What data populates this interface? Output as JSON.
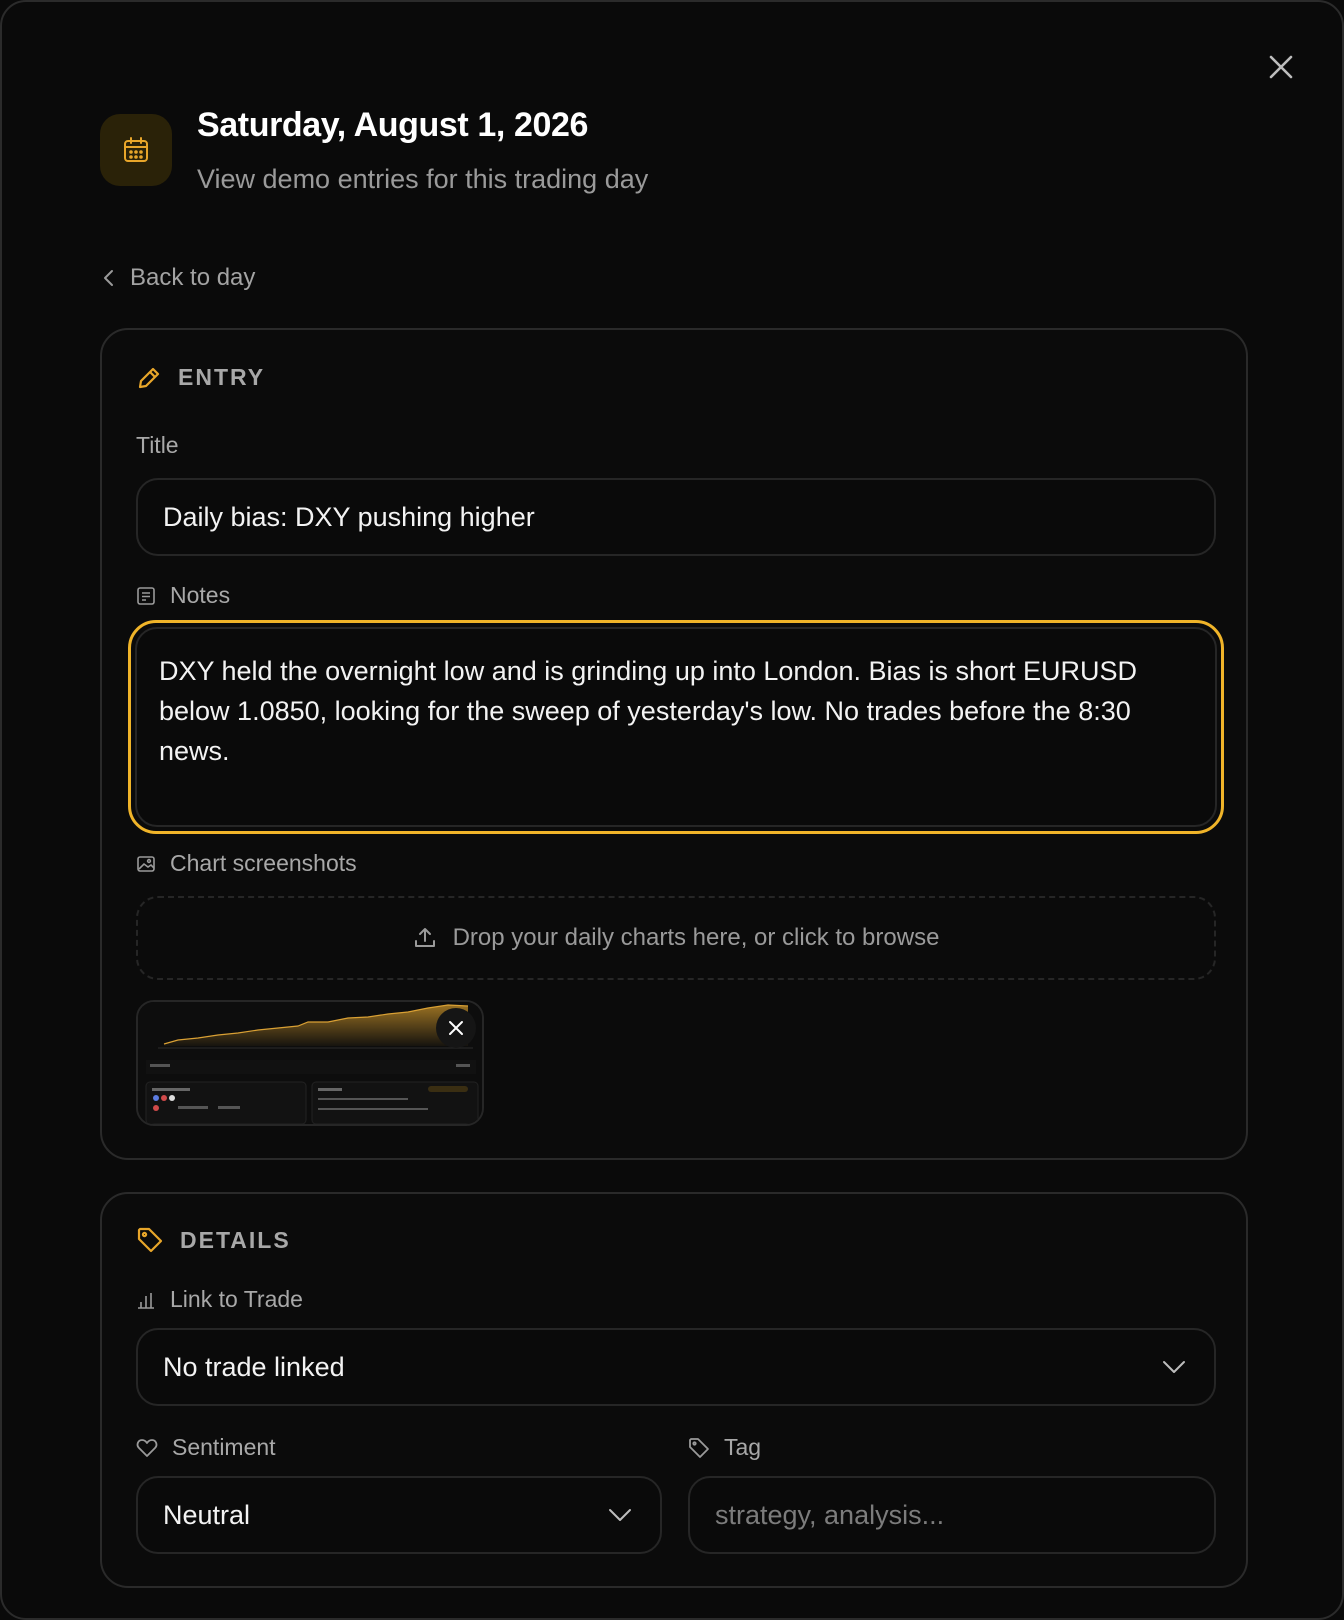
{
  "header": {
    "title": "Saturday, August 1, 2026",
    "subtitle": "View demo entries for this trading day",
    "icon": "calendar-icon"
  },
  "nav": {
    "back_label": "Back to day"
  },
  "entry": {
    "section_label": "ENTRY",
    "title_label": "Title",
    "title_value": "Daily bias: DXY pushing higher",
    "notes_label": "Notes",
    "notes_value": "DXY held the overnight low and is grinding up into London. Bias is short EURUSD below 1.0850, looking for the sweep of yesterday's low. No trades before the 8:30 news.",
    "screenshots_label": "Chart screenshots",
    "dropzone_text": "Drop your daily charts here, or click to browse"
  },
  "details": {
    "section_label": "DETAILS",
    "link_label": "Link to Trade",
    "link_value": "No trade linked",
    "sentiment_label": "Sentiment",
    "sentiment_value": "Neutral",
    "tag_label": "Tag",
    "tag_placeholder": "strategy, analysis..."
  },
  "colors": {
    "accent": "#f0b429",
    "background": "#0a0a0a",
    "border": "#2a2a2a"
  }
}
